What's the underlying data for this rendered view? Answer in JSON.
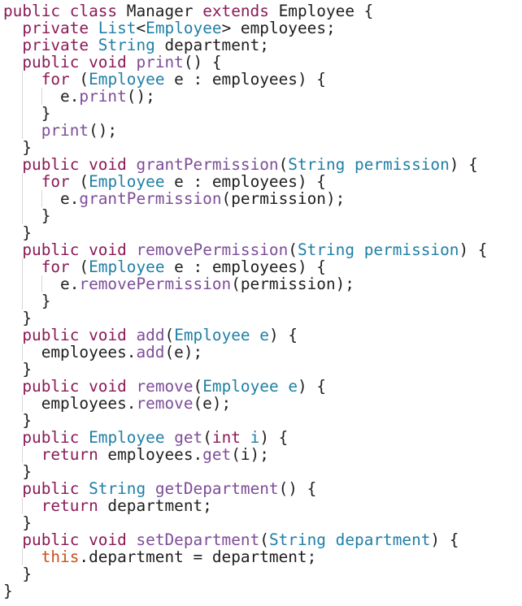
{
  "colors": {
    "background": "#ffffff",
    "keyword": "#8b1a57",
    "type": "#1f7fa6",
    "method": "#7d4d98",
    "parameter": "#1f7fa6",
    "this_keyword": "#c8511b",
    "plain": "#1e1e1e"
  },
  "lines": [
    [
      [
        "keyword",
        "public"
      ],
      [
        "plain",
        " "
      ],
      [
        "keyword",
        "class"
      ],
      [
        "plain",
        " Manager "
      ],
      [
        "keyword",
        "extends"
      ],
      [
        "plain",
        " Employee {"
      ]
    ],
    [
      [
        "plain",
        "  "
      ],
      [
        "keyword",
        "private"
      ],
      [
        "plain",
        " "
      ],
      [
        "type",
        "List"
      ],
      [
        "plain",
        "<"
      ],
      [
        "type",
        "Employee"
      ],
      [
        "plain",
        "> employees;"
      ]
    ],
    [
      [
        "plain",
        "  "
      ],
      [
        "keyword",
        "private"
      ],
      [
        "plain",
        " "
      ],
      [
        "type",
        "String"
      ],
      [
        "plain",
        " department;"
      ]
    ],
    [
      [
        "plain",
        "  "
      ],
      [
        "keyword",
        "public"
      ],
      [
        "plain",
        " "
      ],
      [
        "keyword",
        "void"
      ],
      [
        "plain",
        " "
      ],
      [
        "method",
        "print"
      ],
      [
        "plain",
        "() {"
      ]
    ],
    [
      [
        "plain",
        "    "
      ],
      [
        "keyword",
        "for"
      ],
      [
        "plain",
        " ("
      ],
      [
        "type",
        "Employee"
      ],
      [
        "plain",
        " e : employees) {"
      ]
    ],
    [
      [
        "plain",
        "      e."
      ],
      [
        "method",
        "print"
      ],
      [
        "plain",
        "();"
      ]
    ],
    [
      [
        "plain",
        "    }"
      ]
    ],
    [
      [
        "plain",
        "    "
      ],
      [
        "method",
        "print"
      ],
      [
        "plain",
        "();"
      ]
    ],
    [
      [
        "plain",
        "  }"
      ]
    ],
    [
      [
        "plain",
        "  "
      ],
      [
        "keyword",
        "public"
      ],
      [
        "plain",
        " "
      ],
      [
        "keyword",
        "void"
      ],
      [
        "plain",
        " "
      ],
      [
        "method",
        "grantPermission"
      ],
      [
        "plain",
        "("
      ],
      [
        "type",
        "String"
      ],
      [
        "plain",
        " "
      ],
      [
        "param",
        "permission"
      ],
      [
        "plain",
        ") {"
      ]
    ],
    [
      [
        "plain",
        "    "
      ],
      [
        "keyword",
        "for"
      ],
      [
        "plain",
        " ("
      ],
      [
        "type",
        "Employee"
      ],
      [
        "plain",
        " e : employees) {"
      ]
    ],
    [
      [
        "plain",
        "      e."
      ],
      [
        "method",
        "grantPermission"
      ],
      [
        "plain",
        "(permission);"
      ]
    ],
    [
      [
        "plain",
        "    }"
      ]
    ],
    [
      [
        "plain",
        "  }"
      ]
    ],
    [
      [
        "plain",
        "  "
      ],
      [
        "keyword",
        "public"
      ],
      [
        "plain",
        " "
      ],
      [
        "keyword",
        "void"
      ],
      [
        "plain",
        " "
      ],
      [
        "method",
        "removePermission"
      ],
      [
        "plain",
        "("
      ],
      [
        "type",
        "String"
      ],
      [
        "plain",
        " "
      ],
      [
        "param",
        "permission"
      ],
      [
        "plain",
        ") {"
      ]
    ],
    [
      [
        "plain",
        "    "
      ],
      [
        "keyword",
        "for"
      ],
      [
        "plain",
        " ("
      ],
      [
        "type",
        "Employee"
      ],
      [
        "plain",
        " e : employees) {"
      ]
    ],
    [
      [
        "plain",
        "      e."
      ],
      [
        "method",
        "removePermission"
      ],
      [
        "plain",
        "(permission);"
      ]
    ],
    [
      [
        "plain",
        "    }"
      ]
    ],
    [
      [
        "plain",
        "  }"
      ]
    ],
    [
      [
        "plain",
        "  "
      ],
      [
        "keyword",
        "public"
      ],
      [
        "plain",
        " "
      ],
      [
        "keyword",
        "void"
      ],
      [
        "plain",
        " "
      ],
      [
        "method",
        "add"
      ],
      [
        "plain",
        "("
      ],
      [
        "type",
        "Employee"
      ],
      [
        "plain",
        " "
      ],
      [
        "param",
        "e"
      ],
      [
        "plain",
        ") {"
      ]
    ],
    [
      [
        "plain",
        "    employees."
      ],
      [
        "method",
        "add"
      ],
      [
        "plain",
        "(e);"
      ]
    ],
    [
      [
        "plain",
        "  }"
      ]
    ],
    [
      [
        "plain",
        "  "
      ],
      [
        "keyword",
        "public"
      ],
      [
        "plain",
        " "
      ],
      [
        "keyword",
        "void"
      ],
      [
        "plain",
        " "
      ],
      [
        "method",
        "remove"
      ],
      [
        "plain",
        "("
      ],
      [
        "type",
        "Employee"
      ],
      [
        "plain",
        " "
      ],
      [
        "param",
        "e"
      ],
      [
        "plain",
        ") {"
      ]
    ],
    [
      [
        "plain",
        "    employees."
      ],
      [
        "method",
        "remove"
      ],
      [
        "plain",
        "(e);"
      ]
    ],
    [
      [
        "plain",
        "  }"
      ]
    ],
    [
      [
        "plain",
        "  "
      ],
      [
        "keyword",
        "public"
      ],
      [
        "plain",
        " "
      ],
      [
        "type",
        "Employee"
      ],
      [
        "plain",
        " "
      ],
      [
        "method",
        "get"
      ],
      [
        "plain",
        "("
      ],
      [
        "keyword",
        "int"
      ],
      [
        "plain",
        " "
      ],
      [
        "param",
        "i"
      ],
      [
        "plain",
        ") {"
      ]
    ],
    [
      [
        "plain",
        "    "
      ],
      [
        "keyword",
        "return"
      ],
      [
        "plain",
        " employees."
      ],
      [
        "method",
        "get"
      ],
      [
        "plain",
        "(i);"
      ]
    ],
    [
      [
        "plain",
        "  }"
      ]
    ],
    [
      [
        "plain",
        "  "
      ],
      [
        "keyword",
        "public"
      ],
      [
        "plain",
        " "
      ],
      [
        "type",
        "String"
      ],
      [
        "plain",
        " "
      ],
      [
        "method",
        "getDepartment"
      ],
      [
        "plain",
        "() {"
      ]
    ],
    [
      [
        "plain",
        "    "
      ],
      [
        "keyword",
        "return"
      ],
      [
        "plain",
        " department;"
      ]
    ],
    [
      [
        "plain",
        "  }"
      ]
    ],
    [
      [
        "plain",
        "  "
      ],
      [
        "keyword",
        "public"
      ],
      [
        "plain",
        " "
      ],
      [
        "keyword",
        "void"
      ],
      [
        "plain",
        " "
      ],
      [
        "method",
        "setDepartment"
      ],
      [
        "plain",
        "("
      ],
      [
        "type",
        "String"
      ],
      [
        "plain",
        " "
      ],
      [
        "param",
        "department"
      ],
      [
        "plain",
        ") {"
      ]
    ],
    [
      [
        "plain",
        "    "
      ],
      [
        "this",
        "this"
      ],
      [
        "plain",
        ".department = department;"
      ]
    ],
    [
      [
        "plain",
        "  }"
      ]
    ],
    [
      [
        "plain",
        "}"
      ]
    ]
  ]
}
